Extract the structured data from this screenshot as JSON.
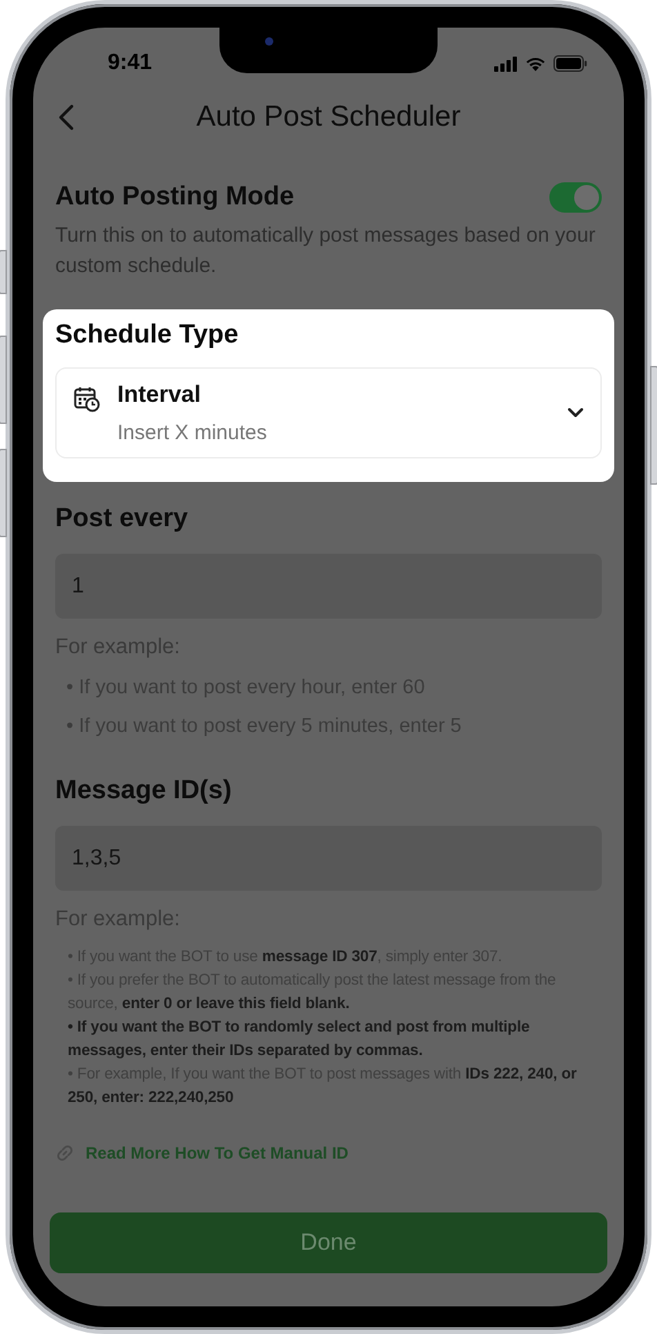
{
  "status_bar": {
    "time": "9:41"
  },
  "header": {
    "title": "Auto Post Scheduler"
  },
  "auto_posting": {
    "title": "Auto Posting Mode",
    "description": "Turn this on to automatically post messages based on your custom schedule.",
    "on": true
  },
  "schedule_type": {
    "title": "Schedule Type",
    "highlighted": true,
    "option": {
      "label": "Interval",
      "hint": "Insert X minutes"
    }
  },
  "post_every": {
    "label": "Post every",
    "value": "1",
    "example_title": "For example:",
    "examples": [
      "• If you want to post every hour, enter 60",
      "• If you want to post every 5 minutes, enter 5"
    ]
  },
  "message_ids": {
    "label": "Message ID(s)",
    "value": "1,3,5",
    "example_title": "For example:",
    "examples": [
      "• If you want the BOT to use **message ID 307**, simply enter 307.",
      "• If you prefer the BOT to automatically post the latest message from the source, **enter 0 or leave this field blank.**",
      "**• If you want the BOT to randomly select and post from multiple messages, enter their IDs separated by commas.**",
      "• For example, If you want the BOT to post messages with **IDs 222, 240, or 250, enter: 222,240,250**"
    ]
  },
  "link": {
    "label": "Read More How To Get Manual ID"
  },
  "done_button": {
    "label": "Done"
  }
}
